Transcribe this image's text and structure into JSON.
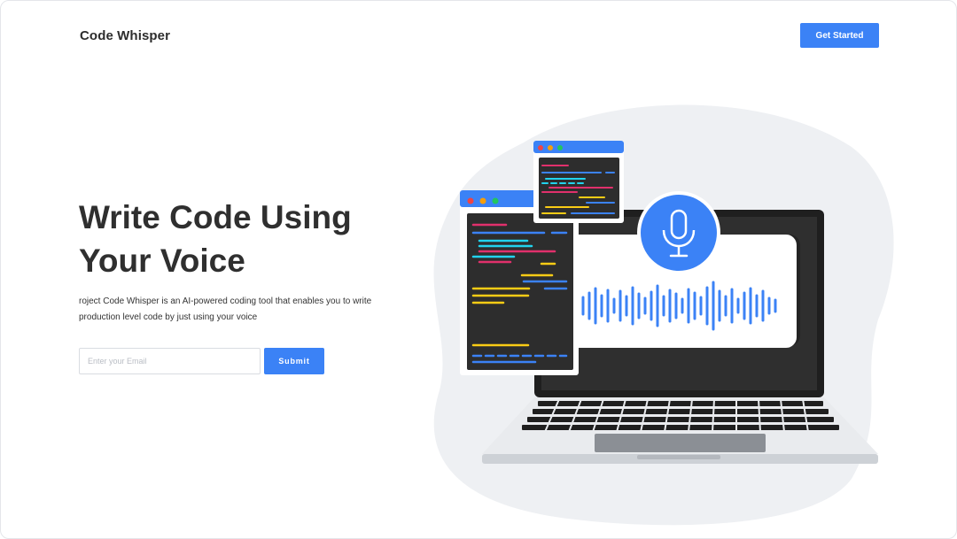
{
  "header": {
    "brand": "Code Whisper",
    "cta_label": "Get Started"
  },
  "hero": {
    "title": "Write Code Using Your Voice",
    "description": "roject Code Whisper is an AI-powered coding tool that enables you to write production level code by just using your voice"
  },
  "signup": {
    "email_placeholder": "Enter your Email",
    "submit_label": "Submit"
  },
  "colors": {
    "accent": "#3b82f6",
    "text": "#2f2f2f",
    "blob": "#eef0f3",
    "code_bg": "#2d2d2d"
  },
  "illustration": {
    "icons": [
      "microphone-icon",
      "sound-wave-icon",
      "laptop-icon",
      "code-window-icon"
    ]
  }
}
